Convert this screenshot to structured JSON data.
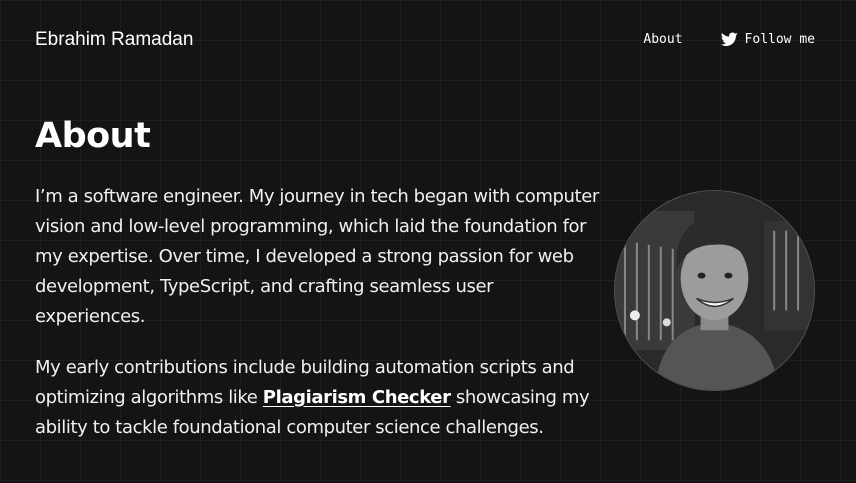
{
  "header": {
    "site_name": "Ebrahim Ramadan",
    "nav": {
      "about_label": "About",
      "follow_label": "Follow me",
      "follow_icon": "twitter-icon"
    }
  },
  "main": {
    "title": "About",
    "paragraph1": "I’m a software engineer. My journey in tech began with computer vision and low-level programming, which laid the foundation for my expertise. Over time, I developed a strong passion for web development, TypeScript, and crafting seamless user experiences.",
    "paragraph2_before": "My early contributions include building automation scripts and optimizing algorithms like ",
    "paragraph2_link": "Plagiarism Checker",
    "paragraph2_after": " showcasing my ability to tackle foundational computer science challenges."
  },
  "colors": {
    "background": "#141414",
    "text": "#f2f2f2"
  }
}
